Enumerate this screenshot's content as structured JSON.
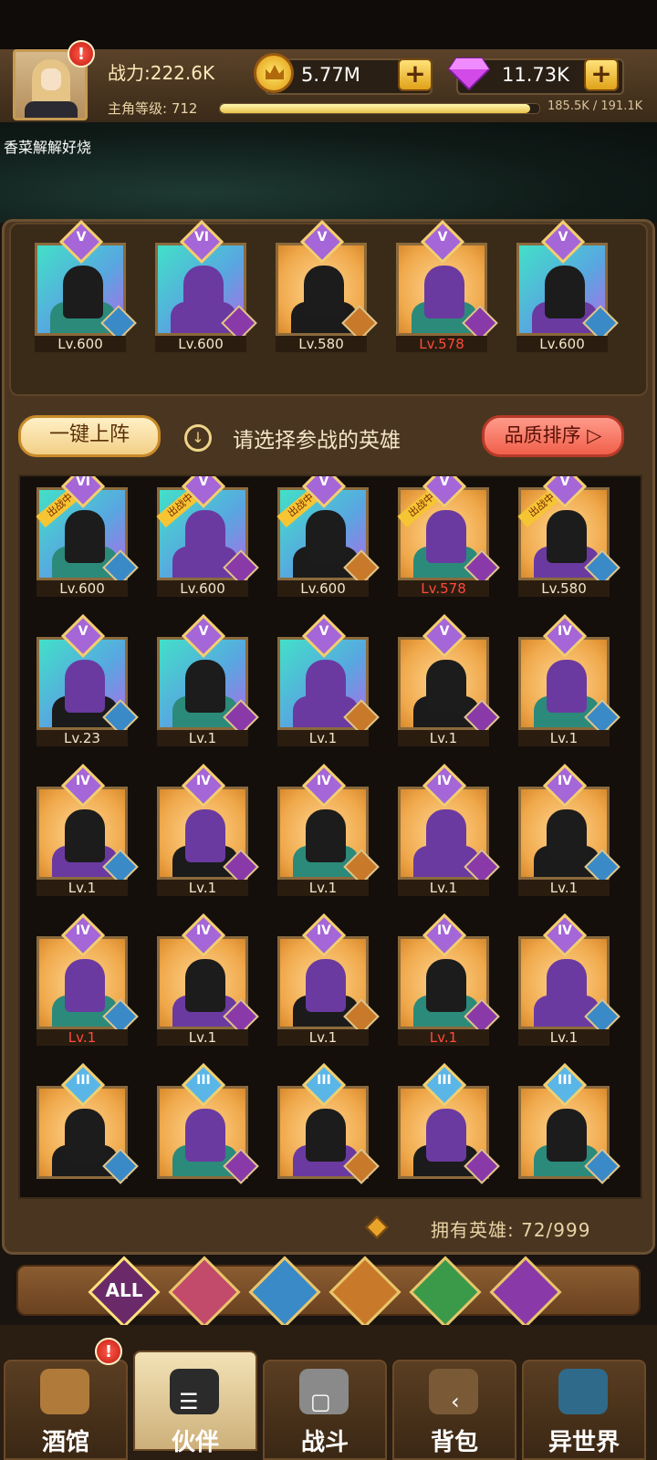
{
  "header": {
    "power": "战力:222.6K",
    "gold": "5.77M",
    "gems": "11.73K",
    "level_label": "主角等级: 712",
    "exp_text": "185.5K / 191.1K",
    "exp_progress": 0.971,
    "player_name": "香菜解解好烧",
    "alert": "!"
  },
  "lineup": [
    {
      "rank": "V",
      "level": "Lv.600",
      "bg": "teal",
      "red": false
    },
    {
      "rank": "VI",
      "level": "Lv.600",
      "bg": "teal",
      "red": false
    },
    {
      "rank": "V",
      "level": "Lv.580",
      "bg": "gold",
      "red": false
    },
    {
      "rank": "V",
      "level": "Lv.578",
      "bg": "gold",
      "red": true
    },
    {
      "rank": "V",
      "level": "Lv.600",
      "bg": "teal",
      "red": false
    }
  ],
  "actions": {
    "auto_label": "一键上阵",
    "hint": "请选择参战的英雄",
    "sort_label": "品质排序 ▷",
    "down_icon": "↓"
  },
  "heroes": [
    {
      "rank": "VI",
      "level": "Lv.600",
      "bg": "teal",
      "red": false,
      "in_battle": true
    },
    {
      "rank": "V",
      "level": "Lv.600",
      "bg": "teal",
      "red": false,
      "in_battle": true
    },
    {
      "rank": "V",
      "level": "Lv.600",
      "bg": "teal",
      "red": false,
      "in_battle": true
    },
    {
      "rank": "V",
      "level": "Lv.578",
      "bg": "gold",
      "red": true,
      "in_battle": true
    },
    {
      "rank": "V",
      "level": "Lv.580",
      "bg": "gold",
      "red": false,
      "in_battle": true
    },
    {
      "rank": "V",
      "level": "Lv.23",
      "bg": "teal",
      "red": false,
      "in_battle": false
    },
    {
      "rank": "V",
      "level": "Lv.1",
      "bg": "teal",
      "red": false,
      "in_battle": false
    },
    {
      "rank": "V",
      "level": "Lv.1",
      "bg": "teal",
      "red": false,
      "in_battle": false
    },
    {
      "rank": "V",
      "level": "Lv.1",
      "bg": "gold",
      "red": false,
      "in_battle": false
    },
    {
      "rank": "IV",
      "level": "Lv.1",
      "bg": "gold",
      "red": false,
      "in_battle": false
    },
    {
      "rank": "IV",
      "level": "Lv.1",
      "bg": "gold",
      "red": false,
      "in_battle": false
    },
    {
      "rank": "IV",
      "level": "Lv.1",
      "bg": "gold",
      "red": false,
      "in_battle": false
    },
    {
      "rank": "IV",
      "level": "Lv.1",
      "bg": "gold",
      "red": false,
      "in_battle": false
    },
    {
      "rank": "IV",
      "level": "Lv.1",
      "bg": "gold",
      "red": false,
      "in_battle": false
    },
    {
      "rank": "IV",
      "level": "Lv.1",
      "bg": "gold",
      "red": false,
      "in_battle": false
    },
    {
      "rank": "IV",
      "level": "Lv.1",
      "bg": "gold",
      "red": true,
      "in_battle": false
    },
    {
      "rank": "IV",
      "level": "Lv.1",
      "bg": "gold",
      "red": false,
      "in_battle": false
    },
    {
      "rank": "IV",
      "level": "Lv.1",
      "bg": "gold",
      "red": false,
      "in_battle": false
    },
    {
      "rank": "IV",
      "level": "Lv.1",
      "bg": "gold",
      "red": true,
      "in_battle": false
    },
    {
      "rank": "IV",
      "level": "Lv.1",
      "bg": "gold",
      "red": false,
      "in_battle": false
    },
    {
      "rank": "III",
      "level": "",
      "bg": "gold",
      "red": false,
      "in_battle": false
    },
    {
      "rank": "III",
      "level": "",
      "bg": "gold",
      "red": false,
      "in_battle": false
    },
    {
      "rank": "III",
      "level": "",
      "bg": "gold",
      "red": false,
      "in_battle": false
    },
    {
      "rank": "III",
      "level": "",
      "bg": "gold",
      "red": false,
      "in_battle": false
    },
    {
      "rank": "III",
      "level": "",
      "bg": "gold",
      "red": false,
      "in_battle": false
    }
  ],
  "in_battle_label": "出战中",
  "owned": "拥有英雄: 72/999",
  "filters": [
    {
      "label": "ALL",
      "icon": "all-filter",
      "color": "#6a2a6a"
    },
    {
      "label": "",
      "icon": "knight-faction-icon",
      "color": "#c24a6a"
    },
    {
      "label": "",
      "icon": "elf-blue-faction-icon",
      "color": "#3a8ac8"
    },
    {
      "label": "",
      "icon": "lion-faction-icon",
      "color": "#c87a2a"
    },
    {
      "label": "",
      "icon": "elf-green-faction-icon",
      "color": "#3a9a4a"
    },
    {
      "label": "",
      "icon": "demon-faction-icon",
      "color": "#8a3aa8"
    }
  ],
  "nav": [
    {
      "label": "酒馆",
      "icon": "tavern-icon",
      "alert": true
    },
    {
      "label": "伙伴",
      "icon": "partner-icon",
      "alert": false,
      "active": true
    },
    {
      "label": "战斗",
      "icon": "battle-icon",
      "alert": false
    },
    {
      "label": "背包",
      "icon": "backpack-icon",
      "alert": false
    },
    {
      "label": "异世界",
      "icon": "portal-icon",
      "alert": false
    }
  ],
  "system": {
    "menu": "☰",
    "home": "▢",
    "back": "‹"
  }
}
